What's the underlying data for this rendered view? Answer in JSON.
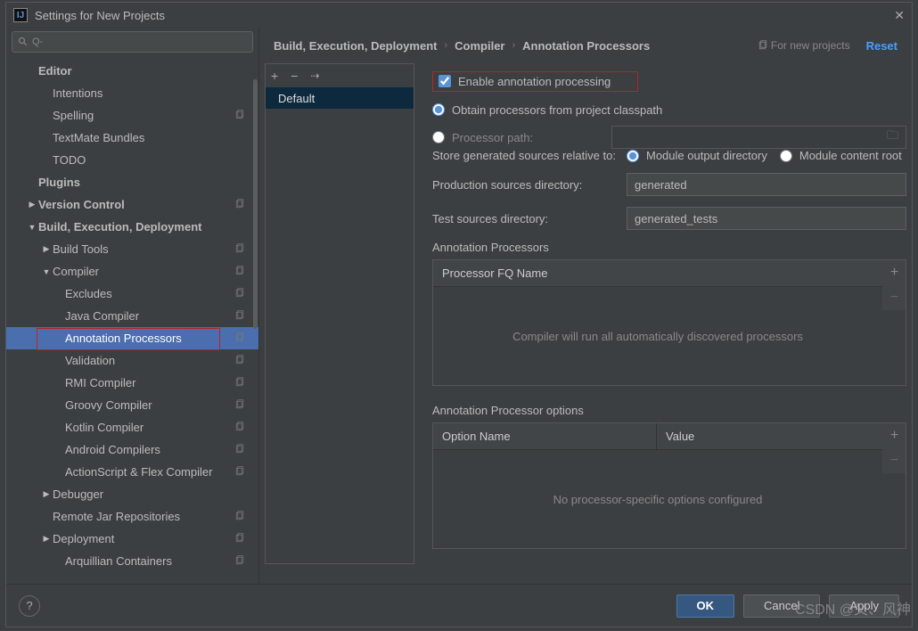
{
  "window": {
    "title": "Settings for New Projects"
  },
  "search": {
    "placeholder": "Q-"
  },
  "tree": [
    {
      "d": 0,
      "bold": true,
      "label": "Editor"
    },
    {
      "d": 1,
      "label": "Intentions"
    },
    {
      "d": 1,
      "label": "Spelling",
      "copy": true
    },
    {
      "d": 1,
      "label": "TextMate Bundles"
    },
    {
      "d": 1,
      "label": "TODO"
    },
    {
      "d": 0,
      "bold": true,
      "label": "Plugins"
    },
    {
      "d": 0,
      "bold": true,
      "label": "Version Control",
      "arrow": "right",
      "copy": true
    },
    {
      "d": 0,
      "bold": true,
      "label": "Build, Execution, Deployment",
      "arrow": "down"
    },
    {
      "d": 1,
      "label": "Build Tools",
      "arrow": "right",
      "copy": true
    },
    {
      "d": 1,
      "label": "Compiler",
      "arrow": "down",
      "copy": true
    },
    {
      "d": 2,
      "label": "Excludes",
      "copy": true
    },
    {
      "d": 2,
      "label": "Java Compiler",
      "copy": true
    },
    {
      "d": 2,
      "label": "Annotation Processors",
      "copy": true,
      "selected": true,
      "highlight": true
    },
    {
      "d": 2,
      "label": "Validation",
      "copy": true
    },
    {
      "d": 2,
      "label": "RMI Compiler",
      "copy": true
    },
    {
      "d": 2,
      "label": "Groovy Compiler",
      "copy": true
    },
    {
      "d": 2,
      "label": "Kotlin Compiler",
      "copy": true
    },
    {
      "d": 2,
      "label": "Android Compilers",
      "copy": true
    },
    {
      "d": 2,
      "label": "ActionScript & Flex Compiler",
      "copy": true
    },
    {
      "d": 1,
      "label": "Debugger",
      "arrow": "right"
    },
    {
      "d": 1,
      "label": "Remote Jar Repositories",
      "copy": true
    },
    {
      "d": 1,
      "label": "Deployment",
      "arrow": "right",
      "copy": true
    },
    {
      "d": 2,
      "label": "Arquillian Containers",
      "copy": true
    }
  ],
  "breadcrumbs": [
    "Build, Execution, Deployment",
    "Compiler",
    "Annotation Processors"
  ],
  "scope_label": "For new projects",
  "reset": "Reset",
  "profiles": {
    "default": "Default"
  },
  "form": {
    "enable_label": "Enable annotation processing",
    "obtain_label": "Obtain processors from project classpath",
    "processor_path_label": "Processor path:",
    "store_label": "Store generated sources relative to:",
    "store_opt1": "Module output directory",
    "store_opt2": "Module content root",
    "prod_label": "Production sources directory:",
    "prod_value": "generated",
    "test_label": "Test sources directory:",
    "test_value": "generated_tests",
    "ap_section": "Annotation Processors",
    "ap_col": "Processor FQ Name",
    "ap_empty": "Compiler will run all automatically discovered processors",
    "opt_section": "Annotation Processor options",
    "opt_col1": "Option Name",
    "opt_col2": "Value",
    "opt_empty": "No processor-specific options configured"
  },
  "buttons": {
    "ok": "OK",
    "cancel": "Cancel",
    "apply": "Apply"
  },
  "watermark": "CSDN @乂、风神"
}
